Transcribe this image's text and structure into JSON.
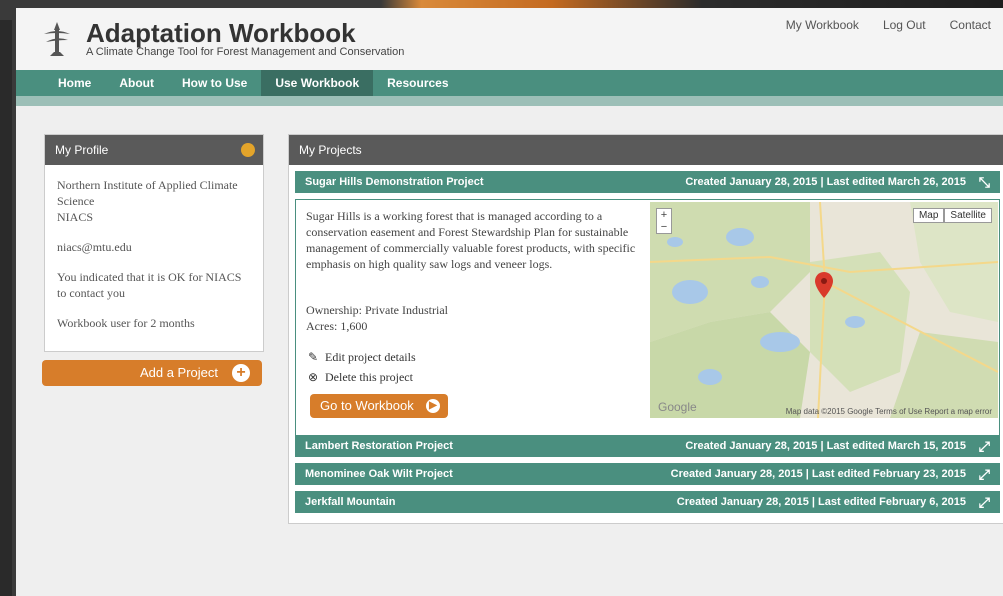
{
  "app": {
    "title": "Adaptation Workbook",
    "subtitle": "A Climate Change Tool for Forest Management and Conservation"
  },
  "top_links": [
    "My Workbook",
    "Log Out",
    "Contact"
  ],
  "nav": {
    "items": [
      "Home",
      "About",
      "How to Use",
      "Use Workbook",
      "Resources"
    ],
    "active": "Use Workbook"
  },
  "profile": {
    "heading": "My Profile",
    "org": "Northern Institute of Applied Climate Science",
    "abbr": "NIACS",
    "email": "niacs@mtu.edu",
    "contact_note": "You indicated that it is OK for NIACS to contact you",
    "tenure": "Workbook user for 2 months",
    "add_label": "Add a Project"
  },
  "projects": {
    "heading": "My Projects",
    "items": [
      {
        "name": "Sugar Hills Demonstration Project",
        "dates": "Created January 28, 2015 | Last edited March 26, 2015",
        "description": "Sugar Hills is a working forest that is managed according to a conservation easement and Forest Stewardship Plan for sustainable management of commercially valuable forest products, with specific emphasis on high quality saw logs and veneer logs.",
        "ownership": "Ownership: Private Industrial",
        "acres": "Acres: 1,600",
        "edit_label": "Edit project details",
        "delete_label": "Delete this project",
        "goto_label": "Go to Workbook"
      },
      {
        "name": "Lambert Restoration Project",
        "dates": "Created January 28, 2015 | Last edited March 15, 2015"
      },
      {
        "name": "Menominee Oak Wilt Project",
        "dates": "Created January 28, 2015 | Last edited February 23, 2015"
      },
      {
        "name": "Jerkfall Mountain",
        "dates": "Created January 28, 2015 | Last edited February 6, 2015"
      }
    ]
  },
  "map": {
    "btn_map": "Map",
    "btn_sat": "Satellite",
    "footer": "Map data ©2015 Google   Terms of Use   Report a map error",
    "brand": "Google"
  },
  "colors": {
    "teal": "#4a8f7f",
    "orange": "#d77d2a"
  }
}
